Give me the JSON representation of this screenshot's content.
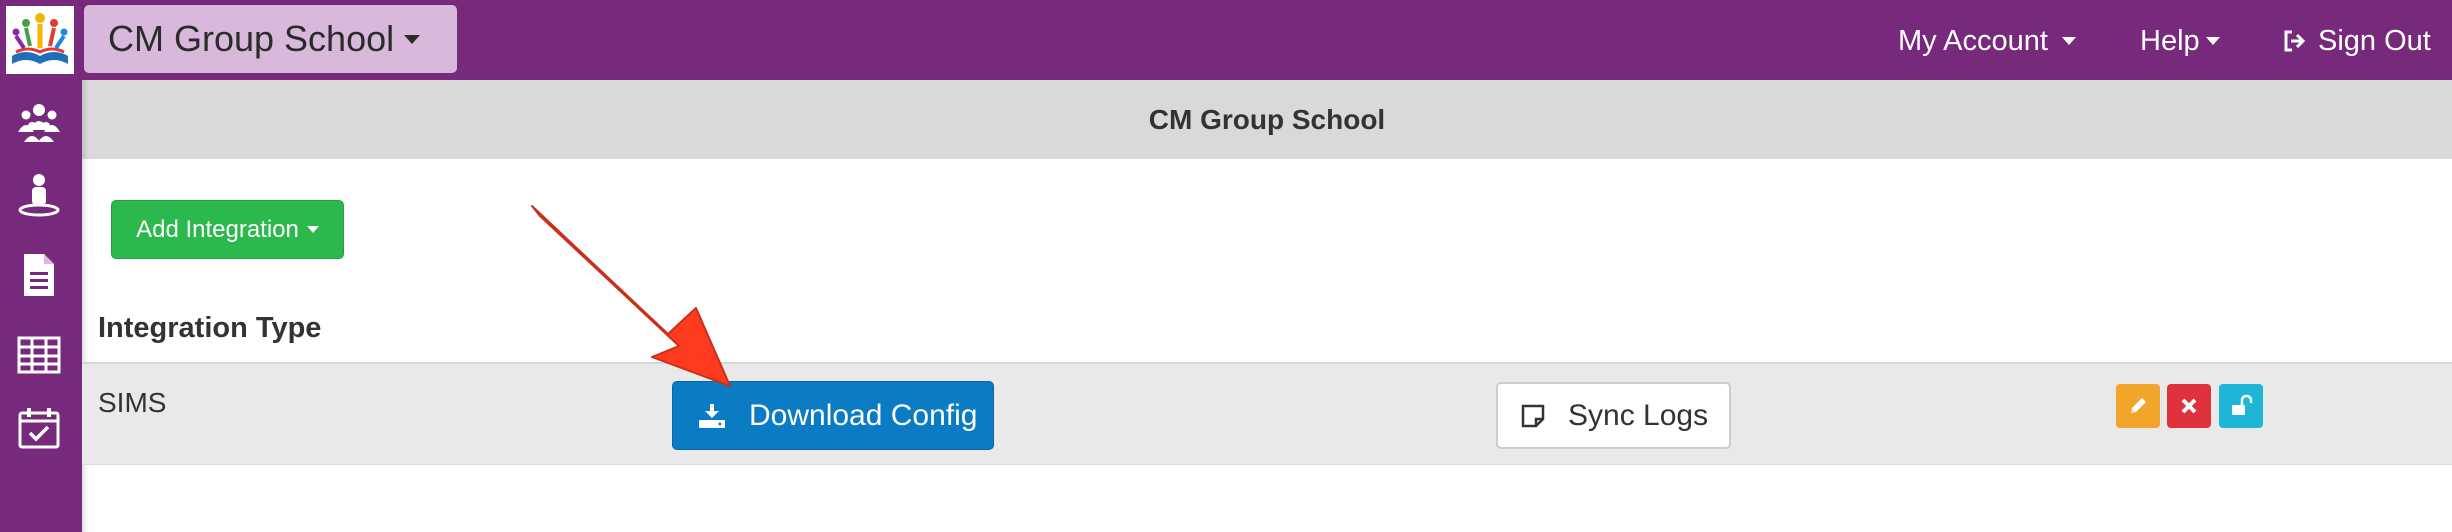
{
  "topbar": {
    "school_selector": "CM Group School",
    "nav": {
      "my_account": "My Account",
      "help": "Help",
      "sign_out": "Sign Out"
    }
  },
  "sidebar": {
    "items": [
      {
        "icon": "group-icon"
      },
      {
        "icon": "user-icon"
      },
      {
        "icon": "document-icon"
      },
      {
        "icon": "table-icon"
      },
      {
        "icon": "calendar-check-icon"
      }
    ]
  },
  "main": {
    "page_title": "CM Group School",
    "add_integration_label": "Add Integration",
    "table": {
      "header": "Integration Type",
      "rows": [
        {
          "type": "SIMS",
          "download_label": "Download Config",
          "sync_logs_label": "Sync Logs",
          "actions": [
            "pencil-icon",
            "close-icon",
            "unlock-icon"
          ]
        }
      ]
    }
  },
  "colors": {
    "brand_purple": "#77297b",
    "success_green": "#2bb84d",
    "primary_blue": "#0b7bc4",
    "warning_orange": "#f2a52b",
    "danger_red": "#e0323d",
    "info_cyan": "#1fb5d6",
    "annotation_arrow": "#ff3b1f"
  }
}
